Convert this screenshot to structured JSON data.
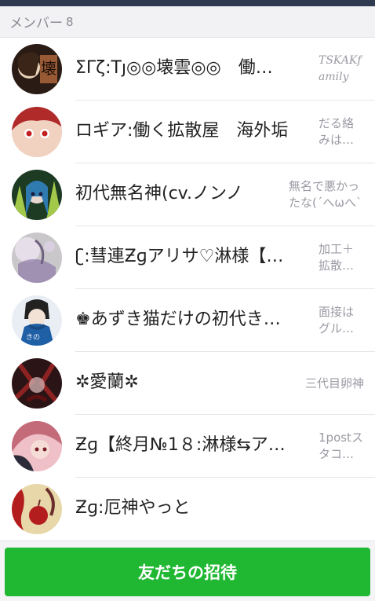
{
  "header": {
    "title": "メンバー",
    "count": "8"
  },
  "members": [
    {
      "name": "ΣΓζ:Tյ◎◎壊雲◎◎　働…",
      "status": "TSKAKf amily",
      "avatar": "avatar-kanji",
      "colors": [
        "#2a1b14",
        "#b36a3c",
        "#e9d2b8"
      ]
    },
    {
      "name": "ロギア:働く拡散屋　海外垢",
      "status": "だる絡みは…",
      "avatar": "avatar-anime-red",
      "colors": [
        "#b02a2a",
        "#f1d1c0",
        "#3a1a1a"
      ]
    },
    {
      "name": "初代無名神(cv.ノンノ",
      "status": "無名で悪かったな(´へωへ`*)",
      "avatar": "avatar-anime-green",
      "colors": [
        "#1d3a23",
        "#2f7bb0",
        "#a3c94b"
      ]
    },
    {
      "name": "ʗ:彗連Ƶɡアリサ♡淋様【…",
      "status": "加工＋拡散…",
      "avatar": "avatar-pastel",
      "colors": [
        "#c9c7c9",
        "#8e7ba8",
        "#e6dfe9"
      ]
    },
    {
      "name": "♚あずき猫だけの初代き…",
      "status": "面接はグル…",
      "avatar": "avatar-anime-blue",
      "colors": [
        "#e9eef4",
        "#1f5fa6",
        "#222"
      ]
    },
    {
      "name": "✲愛蘭✲",
      "status": "三代目卵神",
      "avatar": "avatar-dark-red",
      "colors": [
        "#2a1415",
        "#8d2222",
        "#caa"
      ]
    },
    {
      "name": "Ƶɡ【終月№1８:淋様⇆ア…",
      "status": "1postスタコ…",
      "avatar": "avatar-pink",
      "colors": [
        "#c46b7a",
        "#2b2b3a",
        "#f0c0c8"
      ]
    },
    {
      "name": "Ƶɡ:厄神やっと",
      "status": "",
      "avatar": "avatar-apple",
      "colors": [
        "#e8d7a8",
        "#b31d1d",
        "#6b2c2c"
      ]
    }
  ],
  "invite": {
    "label": "友だちの招待"
  },
  "theme": {
    "accent": "#20b833",
    "status_bar": "#2d3a4f"
  }
}
